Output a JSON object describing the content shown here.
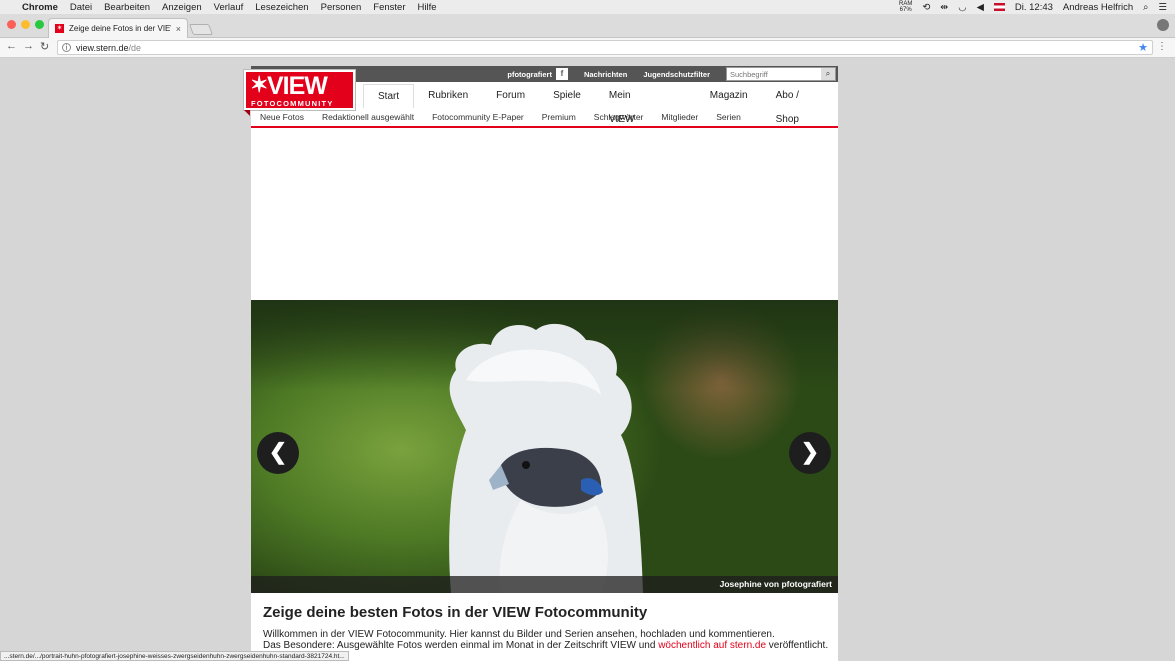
{
  "menubar": {
    "app": "Chrome",
    "items": [
      "Datei",
      "Bearbeiten",
      "Anzeigen",
      "Verlauf",
      "Lesezeichen",
      "Personen",
      "Fenster",
      "Hilfe"
    ],
    "ram_label": "RAM",
    "ram_value": "67%",
    "clock": "Di. 12:43",
    "user": "Andreas Helfrich"
  },
  "tab": {
    "title": "Zeige deine Fotos in der VIEW",
    "close": "×"
  },
  "address": {
    "host": "view.stern.de",
    "path": "/de"
  },
  "site": {
    "logo_word": "VIEW",
    "logo_star": "✶",
    "logo_sub": "FOTOCOMMUNITY",
    "top_links": {
      "pfotografiert": "pfotografiert",
      "pf_badge": "f",
      "nachrichten": "Nachrichten",
      "jugendschutz": "Jugendschutzfilter"
    },
    "search_placeholder": "Suchbegriff",
    "main_nav": [
      "Start",
      "Rubriken",
      "Forum",
      "Spiele",
      "Mein VIEW",
      "Magazin",
      "Abo / Shop"
    ],
    "sub_nav": [
      "Neue Fotos",
      "Redaktionell ausgewählt",
      "Fotocommunity E-Paper",
      "Premium",
      "Schlagwörter",
      "Mitglieder",
      "Serien"
    ]
  },
  "hero": {
    "caption": "Josephine von pfotografiert",
    "prev": "❮",
    "next": "❯"
  },
  "intro": {
    "title": "Zeige deine besten Fotos in der VIEW Fotocommunity",
    "line1": "Willkommen in der VIEW Fotocommunity. Hier kannst du Bilder und Serien ansehen, hochladen und kommentieren.",
    "line2_a": "Das Besondere: Ausgewählte Fotos werden einmal im Monat in der Zeitschrift VIEW und ",
    "line2_link": "wöchentlich auf stern.de",
    "line2_b": " veröffentlicht."
  },
  "status_url": "...stern.de/.../portrait-huhn-pfotografiert-josephine-weisses-zwergseidenhuhn-zwergseidenhuhn-standard-3821724.ht..."
}
